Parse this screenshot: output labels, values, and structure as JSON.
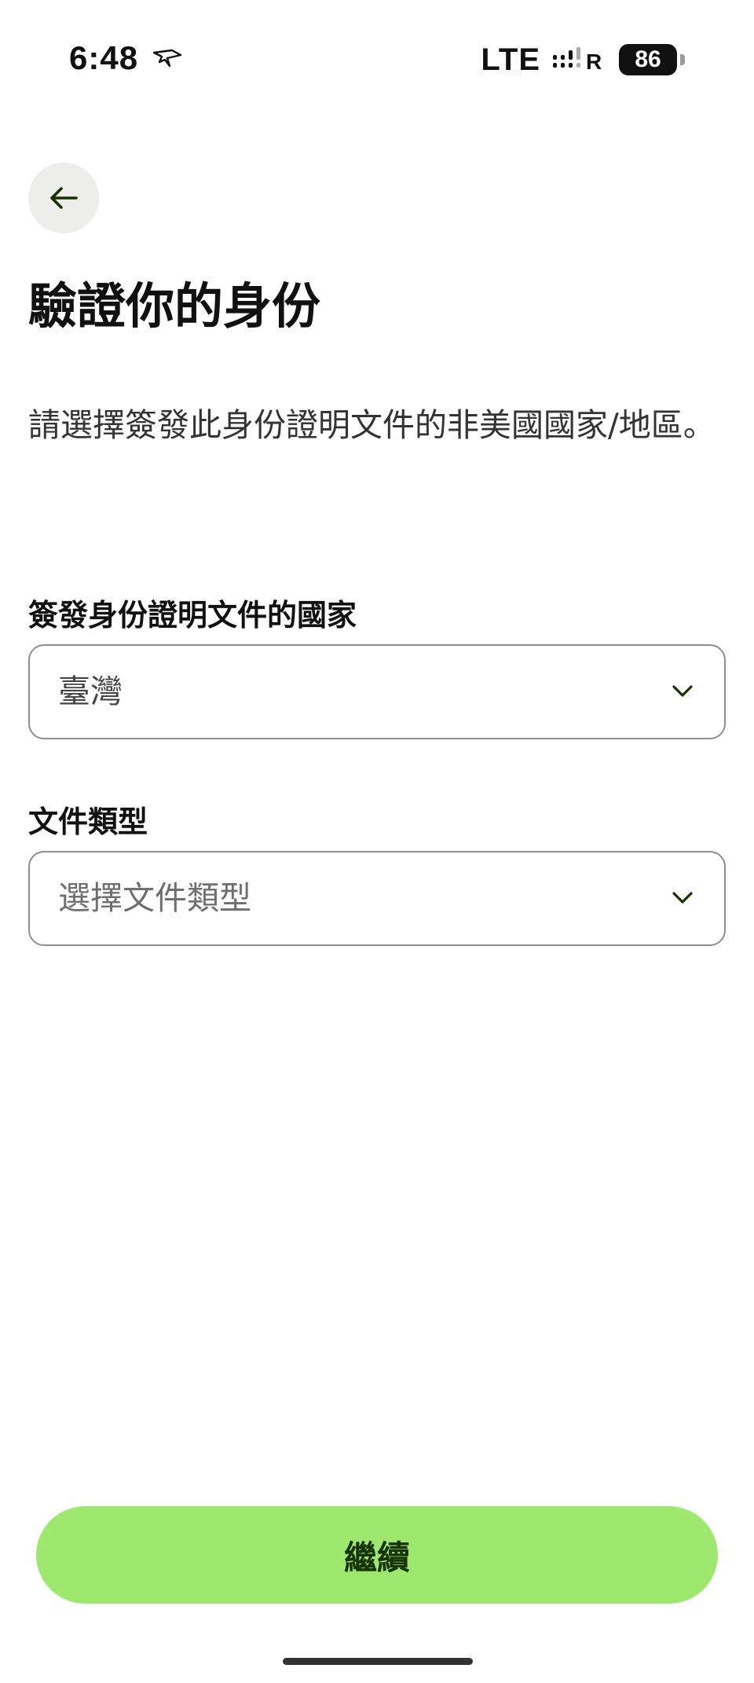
{
  "status_bar": {
    "time": "6:48",
    "network": "LTE",
    "signal_suffix": "R",
    "battery": "86",
    "location_icon": "location-arrow-icon"
  },
  "header": {
    "back_icon": "arrow-left-icon",
    "title": "驗證你的身份"
  },
  "description": "請選擇簽發此身份證明文件的非美國國家/地區。",
  "fields": [
    {
      "label": "簽發身份證明文件的國家",
      "value": "臺灣",
      "placeholder": "",
      "icon": "chevron-down-icon"
    },
    {
      "label": "文件類型",
      "value": "",
      "placeholder": "選擇文件類型",
      "icon": "chevron-down-icon"
    }
  ],
  "footer": {
    "continue_label": "繼續"
  },
  "colors": {
    "accent": "#9fe870",
    "accent_text": "#163300",
    "back_bg": "#ededea",
    "border": "#8e8e8e"
  }
}
